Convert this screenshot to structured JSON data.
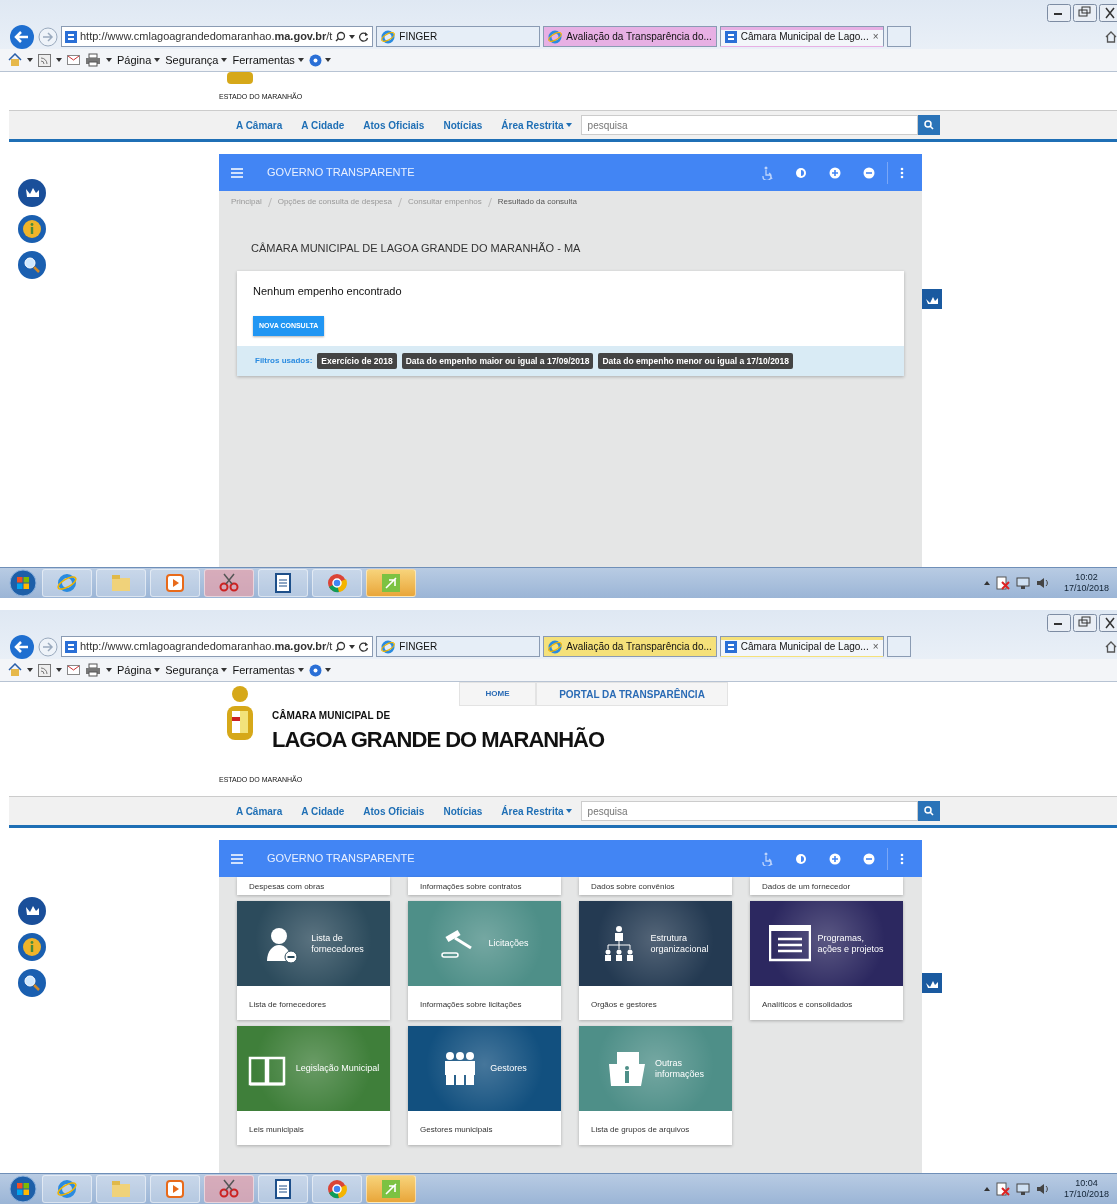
{
  "screens": [
    {
      "kind": "result",
      "browser": {
        "url": "http://www.cmlagoagrandedomaranhao.**ma.gov.br**/t",
        "tabs": [
          {
            "label": "FINGER",
            "selected": false
          },
          {
            "label": "Avaliação da Transparência do...",
            "selected": false,
            "color": "#e7b0e4"
          },
          {
            "label": "Câmara Municipal de Lago...",
            "selected": true,
            "color": "#e7b0e4",
            "close": "×"
          }
        ],
        "menus": [
          "Página",
          "Segurança",
          "Ferramentas"
        ]
      },
      "site": {
        "logo_state": "ESTADO DO MARANHÃO",
        "nav": [
          {
            "label": "A Câmara",
            "dropdown": false
          },
          {
            "label": "A Cidade",
            "dropdown": false
          },
          {
            "label": "Atos Oficiais",
            "dropdown": false
          },
          {
            "label": "Notícias",
            "dropdown": false
          },
          {
            "label": "Área Restrita",
            "dropdown": true
          }
        ],
        "search_placeholder": "pesquisa"
      },
      "panel": {
        "title": "GOVERNO TRANSPARENTE",
        "breadcrumb": [
          {
            "label": "Principal",
            "selected": false
          },
          {
            "label": "Opções de consulta de despesa",
            "selected": false
          },
          {
            "label": "Consultar empenhos",
            "selected": false
          },
          {
            "label": "Resultado da consulta",
            "selected": true
          }
        ],
        "heading": "CÂMARA MUNICIPAL DE LAGOA GRANDE DO MARANHÃO - MA",
        "message": "Nenhum empenho encontrado",
        "button": "NOVA CONSULTA",
        "filters_label": "Filtros usados:",
        "filters": [
          "Exercício de 2018",
          "Data do empenho maior ou igual a 17/09/2018",
          "Data do empenho menor ou igual a 17/10/2018"
        ]
      },
      "taskbar": {
        "time": "10:02",
        "date": "17/10/2018"
      }
    },
    {
      "kind": "cards",
      "browser": {
        "url": "http://www.cmlagoagrandedomaranhao.**ma.gov.br**/t",
        "tabs": [
          {
            "label": "FINGER",
            "selected": false
          },
          {
            "label": "Avaliação da Transparência do...",
            "selected": false,
            "color": "#f5e17a"
          },
          {
            "label": "Câmara Municipal de Lago...",
            "selected": true,
            "color": "#f5e17a",
            "close": "×"
          }
        ],
        "menus": [
          "Página",
          "Segurança",
          "Ferramentas"
        ]
      },
      "site": {
        "top_links": [
          "HOME",
          "PORTAL DA TRANSPARÊNCIA"
        ],
        "logo_line1": "CÂMARA MUNICIPAL DE",
        "logo_line2": "LAGOA GRANDE DO MARANHÃO",
        "logo_state": "ESTADO DO MARANHÃO",
        "nav": [
          {
            "label": "A Câmara",
            "dropdown": false
          },
          {
            "label": "A Cidade",
            "dropdown": false
          },
          {
            "label": "Atos Oficiais",
            "dropdown": false
          },
          {
            "label": "Notícias",
            "dropdown": false
          },
          {
            "label": "Área Restrita",
            "dropdown": true
          }
        ],
        "search_placeholder": "pesquisa"
      },
      "panel": {
        "title": "GOVERNO TRANSPARENTE",
        "partial_cards": [
          "Despesas com obras",
          "Informações sobre contratos",
          "Dados sobre convênios",
          "Dados de um fornecedor"
        ],
        "cards": [
          {
            "title": "Lista de\nfornecedores",
            "caption": "Lista de fornecedores",
            "kind": "person-minus",
            "color": "#2c4b5c"
          },
          {
            "title": "Licitações",
            "caption": "Informações sobre licitações",
            "kind": "gavel",
            "color": "#4e8f88"
          },
          {
            "title": "Estrutura\norganizacional",
            "caption": "Orgãos e gestores",
            "kind": "org",
            "color": "#243a52"
          },
          {
            "title": "Programas,\nações e projetos",
            "caption": "Analíticos e consolidados",
            "kind": "document",
            "color": "#2c2860"
          },
          {
            "title": "Legislação Municipal",
            "caption": "Leis municipais",
            "kind": "book",
            "color": "#3f7f3a"
          },
          {
            "title": "Gestores",
            "caption": "Gestores municipais",
            "kind": "people",
            "color": "#12507f"
          },
          {
            "title": "Outras\ninformações",
            "caption": "Lista de grupos de arquivos",
            "kind": "folder",
            "color": "#4e8f88"
          }
        ]
      },
      "taskbar": {
        "time": "10:04",
        "date": "17/10/2018"
      }
    }
  ]
}
